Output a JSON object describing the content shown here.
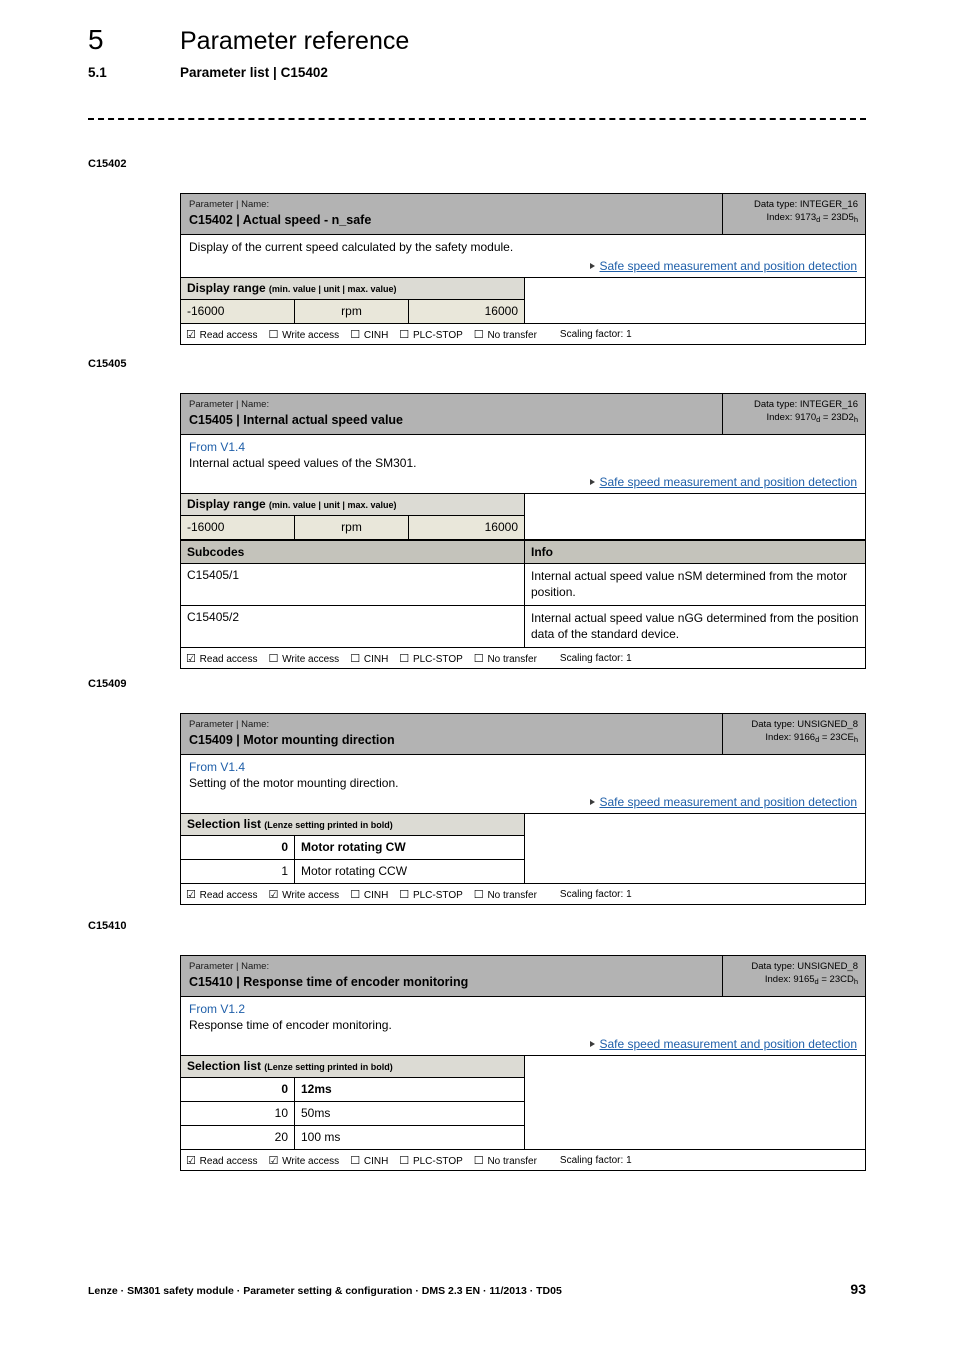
{
  "header": {
    "chapter_number": "5",
    "chapter_title": "Parameter reference",
    "section_number": "5.1",
    "section_title": "Parameter list | C15402"
  },
  "labels": {
    "parameter_kicker": "Parameter | Name:",
    "display_range_title": "Display range",
    "display_range_sub": "(min. value | unit | max. value)",
    "selection_list_title": "Selection list",
    "selection_list_sub": "(Lenze setting printed in bold)",
    "subcodes_header": "Subcodes",
    "info_header": "Info",
    "read_access": "Read access",
    "write_access": "Write access",
    "cinh": "CINH",
    "plc_stop": "PLC-STOP",
    "no_transfer": "No transfer",
    "scaling_factor": "Scaling factor: 1",
    "checked_box": "☑",
    "unchecked_box": "☐",
    "xref_label": "Safe speed measurement and position detection"
  },
  "colors": {
    "title_band": "#b3b3b3",
    "bar_band": "#dcdbd4",
    "value_row": "#e9e7da",
    "subcodes_header": "#c4c3bb",
    "link": "#1f5fa9",
    "border": "#000000"
  },
  "parameters": [
    {
      "margin_label": "C15402",
      "code": "C15402",
      "name": "Actual speed - n_safe",
      "title": "C15402 | Actual speed - n_safe",
      "data_type": "Data type: INTEGER_16",
      "index_prefix": "Index: 9173",
      "index_sub_dec": "d",
      "index_eq": " = 23D5",
      "index_sub_hex": "h",
      "from_version": "",
      "description": "Display of the current speed calculated by the safety module.",
      "xref": "Safe speed measurement and position detection",
      "display_range": {
        "min": "-16000",
        "unit": "rpm",
        "max": "16000"
      },
      "subcodes": [],
      "selection_list": [],
      "access": {
        "read": true,
        "write": false,
        "cinh": false,
        "plc_stop": false,
        "no_transfer": false,
        "scaling": "Scaling factor: 1"
      }
    },
    {
      "margin_label": "C15405",
      "code": "C15405",
      "name": "Internal actual speed value",
      "title": "C15405 | Internal actual speed value",
      "data_type": "Data type: INTEGER_16",
      "index_prefix": "Index: 9170",
      "index_sub_dec": "d",
      "index_eq": " = 23D2",
      "index_sub_hex": "h",
      "from_version": "From V1.4",
      "description": "Internal actual speed values of the SM301.",
      "xref": "Safe speed measurement and position detection",
      "display_range": {
        "min": "-16000",
        "unit": "rpm",
        "max": "16000"
      },
      "subcodes": [
        {
          "code": "C15405/1",
          "info": "Internal actual speed value nSM determined from the motor position."
        },
        {
          "code": "C15405/2",
          "info": "Internal actual speed value nGG determined from the position data of the standard device."
        }
      ],
      "selection_list": [],
      "access": {
        "read": true,
        "write": false,
        "cinh": false,
        "plc_stop": false,
        "no_transfer": false,
        "scaling": "Scaling factor: 1"
      }
    },
    {
      "margin_label": "C15409",
      "code": "C15409",
      "name": "Motor mounting direction",
      "title": "C15409 | Motor mounting direction",
      "data_type": "Data type: UNSIGNED_8",
      "index_prefix": "Index: 9166",
      "index_sub_dec": "d",
      "index_eq": " = 23CE",
      "index_sub_hex": "h",
      "from_version": "From V1.4",
      "description": "Setting of the motor mounting direction.",
      "xref": "Safe speed measurement and position detection",
      "display_range": null,
      "subcodes": [],
      "selection_list": [
        {
          "value": "0",
          "text": "Motor rotating CW",
          "default": true
        },
        {
          "value": "1",
          "text": "Motor rotating CCW",
          "default": false
        }
      ],
      "access": {
        "read": true,
        "write": true,
        "cinh": false,
        "plc_stop": false,
        "no_transfer": false,
        "scaling": "Scaling factor: 1"
      }
    },
    {
      "margin_label": "C15410",
      "code": "C15410",
      "name": "Response time of encoder monitoring",
      "title": "C15410 | Response time of encoder monitoring",
      "data_type": "Data type: UNSIGNED_8",
      "index_prefix": "Index: 9165",
      "index_sub_dec": "d",
      "index_eq": " = 23CD",
      "index_sub_hex": "h",
      "from_version": "From V1.2",
      "description": "Response time of encoder monitoring.",
      "xref": "Safe speed measurement and position detection",
      "display_range": null,
      "subcodes": [],
      "selection_list": [
        {
          "value": "0",
          "text": "12ms",
          "default": true
        },
        {
          "value": "10",
          "text": "50ms",
          "default": false
        },
        {
          "value": "20",
          "text": "100 ms",
          "default": false
        }
      ],
      "access": {
        "read": true,
        "write": true,
        "cinh": false,
        "plc_stop": false,
        "no_transfer": false,
        "scaling": "Scaling factor: 1"
      }
    }
  ],
  "footer": {
    "text": "Lenze · SM301 safety module · Parameter setting & configuration · DMS 2.3 EN · 11/2013 · TD05",
    "page_number": "93"
  }
}
